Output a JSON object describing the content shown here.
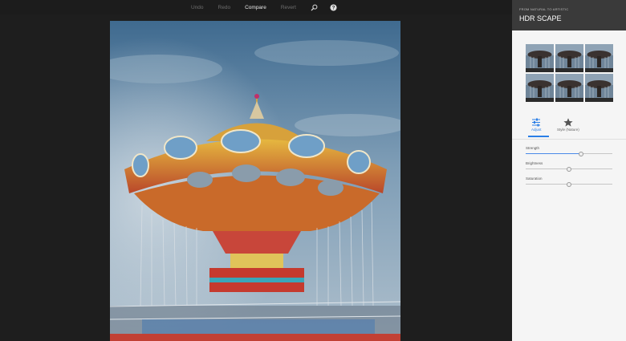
{
  "toolbar": {
    "undo_label": "Undo",
    "redo_label": "Redo",
    "compare_label": "Compare",
    "revert_label": "Revert",
    "zoom_icon": "magnifier-icon",
    "help_icon": "help-icon"
  },
  "panel": {
    "subtitle": "FROM NATURAL TO ARTISTIC",
    "title": "HDR SCAPE",
    "preset_count": 6,
    "tabs": [
      {
        "label": "Adjust",
        "icon": "sliders-icon",
        "active": true
      },
      {
        "label": "Style (Nature)",
        "icon": "star-icon",
        "active": false
      }
    ],
    "sliders": [
      {
        "label": "Strength",
        "value": 0.64
      },
      {
        "label": "Brightness",
        "value": 0.5
      },
      {
        "label": "Saturation",
        "value": 0.5
      }
    ]
  },
  "colors": {
    "accent": "#2a7ee6",
    "panel_header": "#3a3a3a",
    "panel_bg": "#f5f5f5",
    "canvas_bg": "#1e1e1e"
  }
}
